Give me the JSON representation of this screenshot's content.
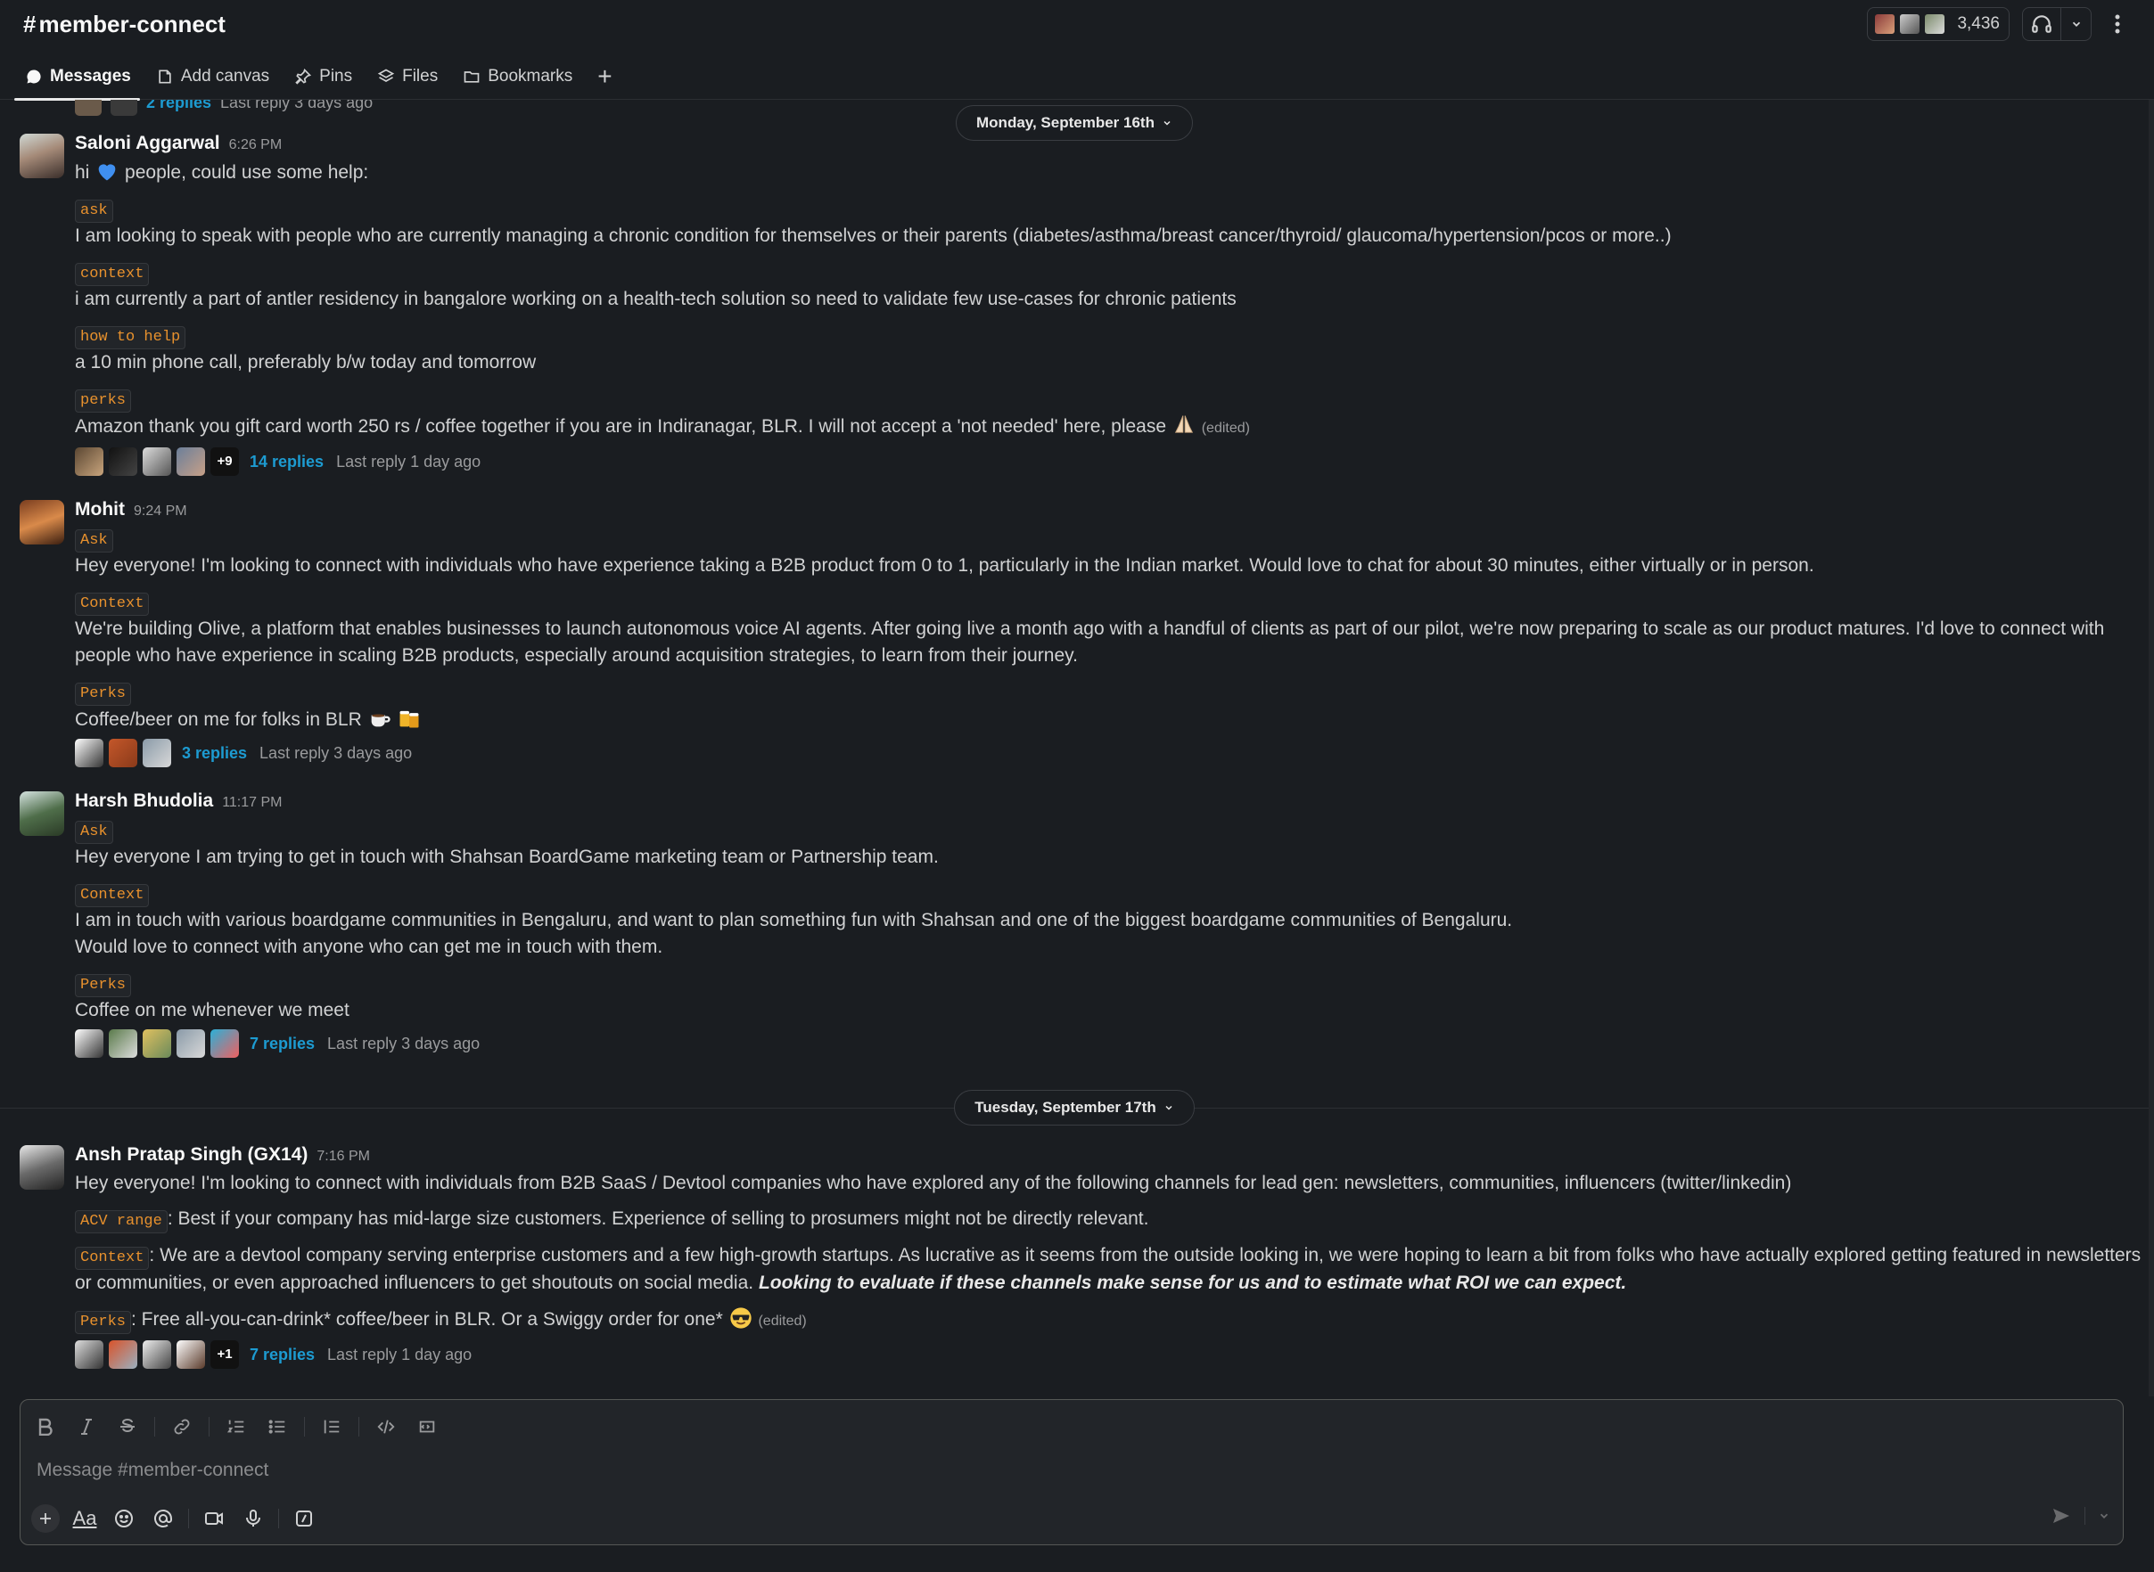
{
  "header": {
    "hash": "#",
    "channel_name": "member-connect",
    "member_count": "3,436"
  },
  "tabs": [
    {
      "label": "Messages",
      "icon": "message-bubble-icon"
    },
    {
      "label": "Add canvas",
      "icon": "canvas-icon"
    },
    {
      "label": "Pins",
      "icon": "pin-icon"
    },
    {
      "label": "Files",
      "icon": "files-icon"
    },
    {
      "label": "Bookmarks",
      "icon": "folder-icon"
    },
    {
      "label": "+",
      "icon": "plus-icon"
    }
  ],
  "prev_thread": {
    "replies": "2 replies",
    "last": "Last reply 3 days ago"
  },
  "date_separators": [
    {
      "label": "Monday, September 16th"
    },
    {
      "label": "Tuesday, September 17th"
    }
  ],
  "messages": [
    {
      "author": "Saloni Aggarwal",
      "time": "6:26 PM",
      "greeting_pre": "hi",
      "greeting_post": "people, could use some help:",
      "tags": [
        "ask",
        "context",
        "how to help",
        "perks"
      ],
      "lines": [
        "I am looking to speak with people who are currently managing a chronic condition for themselves or their parents (diabetes/asthma/breast cancer/thyroid/ glaucoma/hypertension/pcos or more..)",
        "i am currently a part of antler residency in bangalore working on a health-tech solution so need to validate few use-cases for chronic patients",
        "a 10 min phone call, preferably b/w today and tomorrow",
        "Amazon thank you gift card worth 250 rs / coffee together if you are in Indiranagar, BLR. I will not accept a 'not needed' here, please"
      ],
      "edited": "(edited)",
      "thread_more": "+9",
      "replies": "14 replies",
      "last_reply": "Last reply 1 day ago"
    },
    {
      "author": "Mohit",
      "time": "9:24 PM",
      "tags": [
        "Ask",
        "Context",
        "Perks"
      ],
      "lines": [
        "Hey everyone! I'm looking to connect with individuals who have experience taking a B2B product from 0 to 1, particularly in the Indian market. Would love to chat for about 30 minutes, either virtually or in person.",
        "We're building Olive, a platform that enables businesses to launch autonomous voice AI agents. After going live a month ago with a handful of clients as part of our pilot, we're now preparing to scale as our product matures. I'd love to connect with",
        "people who have experience in scaling B2B products, especially around acquisition strategies, to learn from their journey.",
        "Coffee/beer on me for folks in BLR"
      ],
      "replies": "3 replies",
      "last_reply": "Last reply 3 days ago"
    },
    {
      "author": "Harsh Bhudolia",
      "time": "11:17 PM",
      "tags": [
        "Ask",
        "Context",
        "Perks"
      ],
      "lines": [
        "Hey everyone I am trying to get in touch with Shahsan BoardGame marketing team or Partnership team.",
        "I am in touch with various boardgame communities in Bengaluru, and want to plan something fun with Shahsan and one of the biggest boardgame communities of Bengaluru.",
        "Would love to connect with anyone who can get me in touch with them.",
        "Coffee on me whenever we meet"
      ],
      "replies": "7 replies",
      "last_reply": "Last reply 3 days ago"
    },
    {
      "author": "Ansh Pratap Singh (GX14)",
      "time": "7:16 PM",
      "tags": [
        "ACV range",
        "Context",
        "Perks"
      ],
      "lines": [
        "Hey everyone! I'm looking to connect with individuals from B2B SaaS / Devtool companies who have explored any of the following channels for lead gen: newsletters, communities, influencers (twitter/linkedin)",
        ": Best if your company has mid-large size customers. Experience of selling to prosumers might not be directly relevant.",
        ": We are a devtool company serving enterprise customers and a few high-growth startups. As lucrative as it seems from the outside looking in, we were hoping to learn a bit from folks who have actually explored getting featured in newsletters",
        "or communities, or even approached influencers to get shoutouts on social media.",
        "Looking to evaluate if these channels make sense for us and to estimate what ROI we can expect.",
        ": Free all-you-can-drink* coffee/beer in BLR. Or a Swiggy order for one*"
      ],
      "edited": "(edited)",
      "thread_more": "+1",
      "replies": "7 replies",
      "last_reply": "Last reply 1 day ago"
    }
  ],
  "composer": {
    "placeholder": "Message #member-connect",
    "format_aa": "Aa"
  },
  "colors": {
    "background": "#1a1d21",
    "link": "#1d9bd1",
    "code_text": "#e8912d"
  }
}
